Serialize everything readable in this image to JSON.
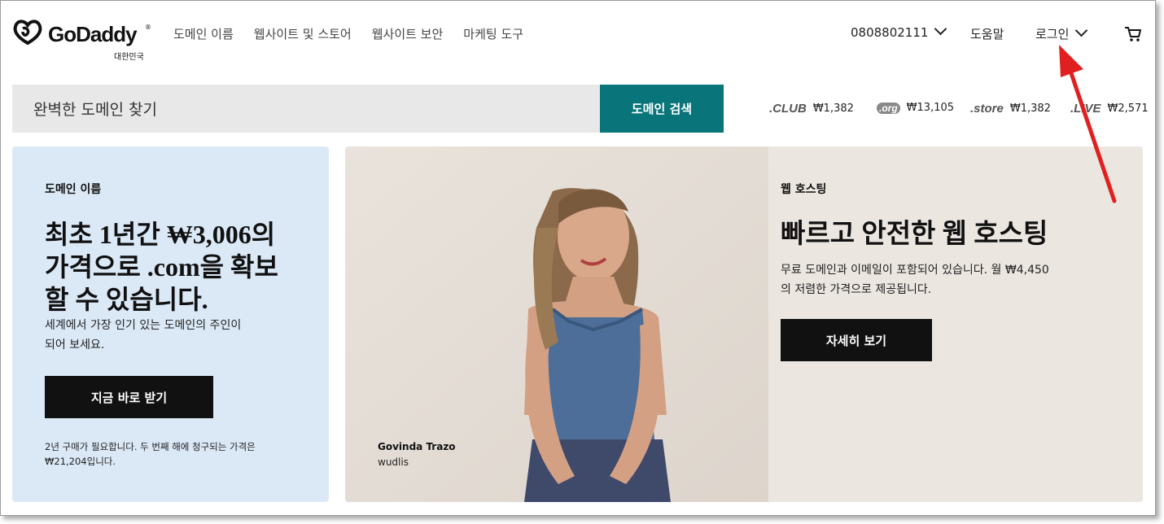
{
  "header": {
    "logo_text": "GoDaddy",
    "logo_tm": "®",
    "logo_region": "대한민국",
    "nav": [
      "도메인 이름",
      "웹사이트 및 스토어",
      "웹사이트 보안",
      "마케팅 도구"
    ],
    "phone": "0808802111",
    "help": "도움말",
    "login": "로그인",
    "cart_icon": "cart-icon"
  },
  "search": {
    "placeholder": "완벽한 도메인 찾기",
    "button": "도메인 검색"
  },
  "tlds": [
    {
      "name": ".CLUB",
      "price": "₩1,382"
    },
    {
      "name": ".org",
      "price": "₩13,105"
    },
    {
      "name": ".store",
      "price": "₩1,382"
    },
    {
      "name": ".LIVE",
      "price": "₩2,571"
    }
  ],
  "domain_card": {
    "eyebrow": "도메인 이름",
    "headline_lines": [
      "최초 1년간 ₩3,006의",
      "가격으로 .com을 확보",
      "할 수 있습니다."
    ],
    "desc_lines": [
      "세계에서 가장 인기 있는 도메인의 주인이",
      "되어 보세요."
    ],
    "button": "지금 바로 받기",
    "fine_lines": [
      "2년 구매가 필요합니다. 두 번째 해에 청구되는 가격은",
      "₩21,204입니다."
    ]
  },
  "hosting_card": {
    "eyebrow": "웹 호스팅",
    "headline": "빠르고 안전한 웹 호스팅",
    "desc_lines": [
      "무료 도메인과 이메일이 포함되어 있습니다. 월 ₩4,450",
      "의 저렴한 가격으로 제공됩니다."
    ],
    "button": "자세히 보기",
    "credit_name": "Govinda Trazo",
    "credit_user": "wudlis"
  },
  "colors": {
    "accent_teal": "#09757a",
    "domain_card_bg": "#dbe9f7",
    "hosting_card_bg": "#ebe6e0",
    "annotation_arrow": "#e02020"
  }
}
